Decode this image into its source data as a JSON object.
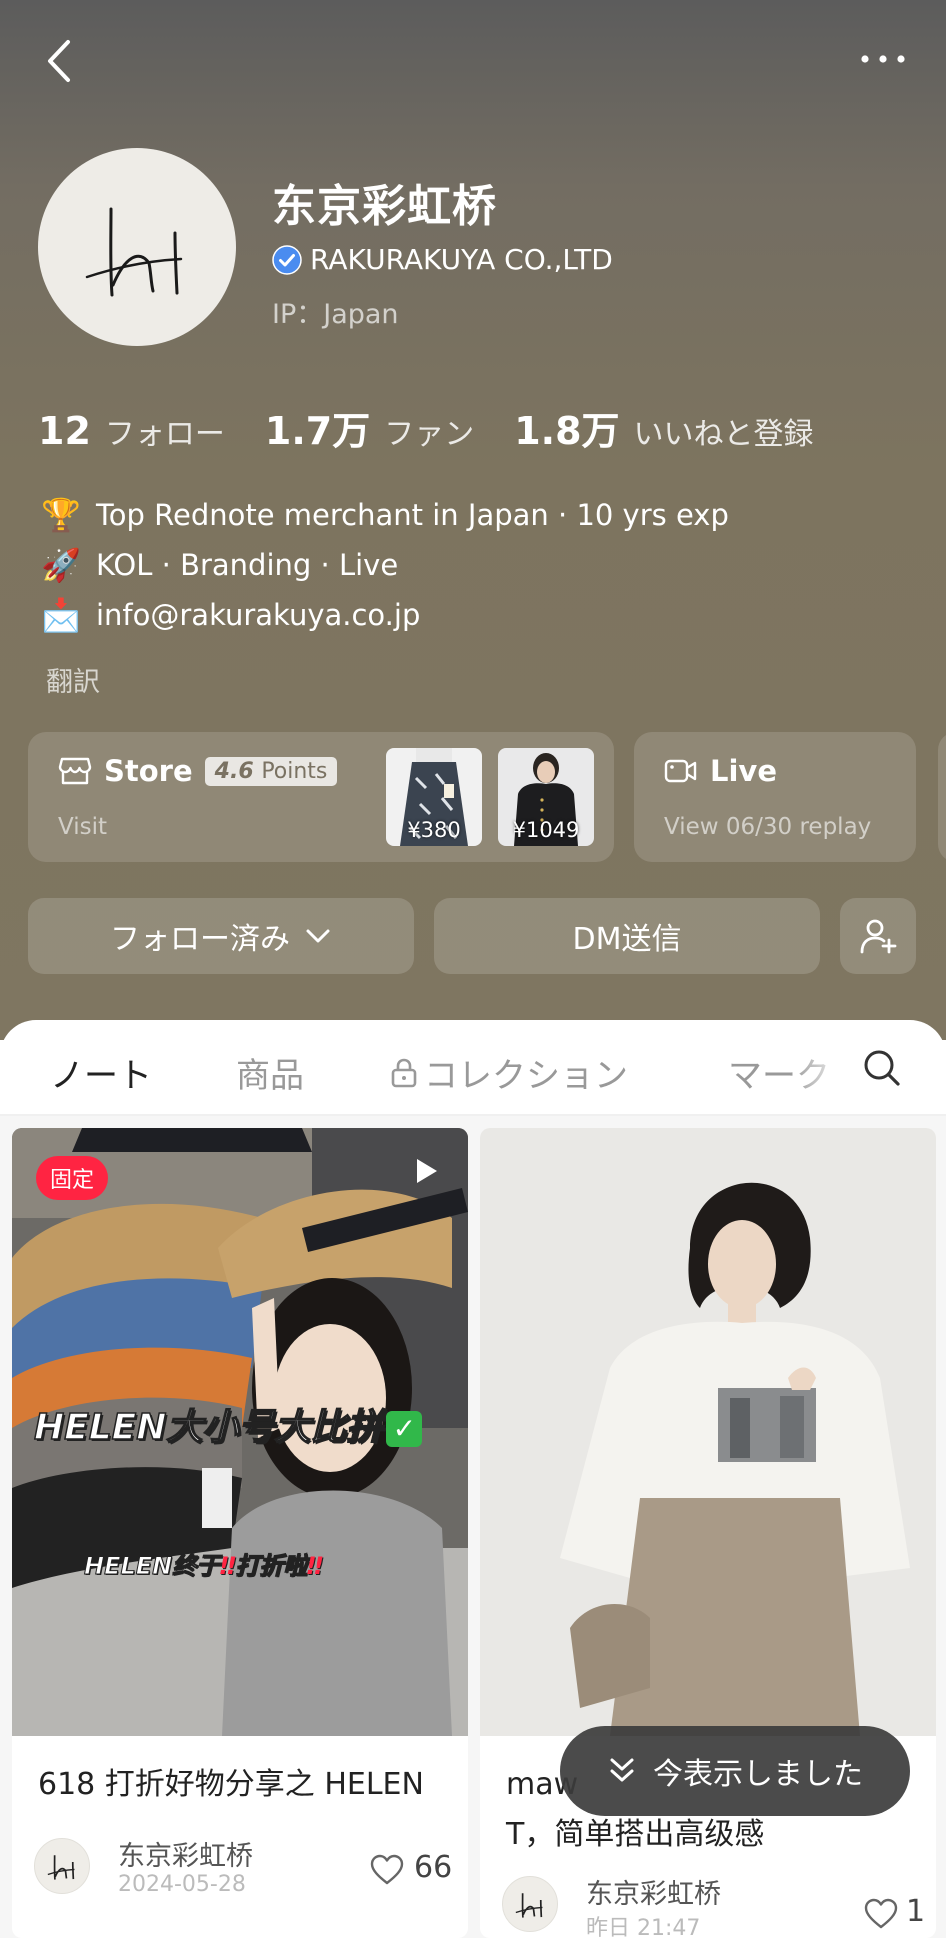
{
  "profile": {
    "name": "东京彩虹桥",
    "company": "RAKURAKUYA CO.,LTD",
    "ip": "IP：Japan"
  },
  "stats": [
    {
      "value": "12",
      "label": "フォロー"
    },
    {
      "value": "1.7万",
      "label": "ファン"
    },
    {
      "value": "1.8万",
      "label": "いいねと登録"
    }
  ],
  "bio": [
    {
      "icon": "trophy-icon",
      "emoji": "🏆",
      "text": "Top Rednote merchant in Japan · 10 yrs exp"
    },
    {
      "icon": "rocket-icon",
      "emoji": "🚀",
      "text": "KOL · Branding · Live"
    },
    {
      "icon": "envelope-icon",
      "emoji": "📩",
      "text": "info@rakurakuya.co.jp"
    }
  ],
  "translate_label": "翻訳",
  "store": {
    "title": "Store",
    "points_value": "4.6",
    "points_label": "Points",
    "sub": "Visit",
    "products": [
      {
        "price": "¥380"
      },
      {
        "price": "¥1049"
      }
    ]
  },
  "live": {
    "title": "Live",
    "sub": "View 06/30 replay"
  },
  "actions": {
    "follow_label": "フォロー済み",
    "dm_label": "DM送信"
  },
  "tabs": [
    {
      "label": "ノート",
      "active": true
    },
    {
      "label": "商品",
      "active": false
    },
    {
      "label": "コレクション",
      "active": false,
      "locked": true
    },
    {
      "label": "マーク",
      "active": false
    }
  ],
  "notes": [
    {
      "pinned_label": "固定",
      "overlay_main": "HELEN大小号大比拼",
      "overlay_sub_a": "HELEN终于",
      "overlay_sub_b": "打折啦",
      "title": "618 打折好物分享之 HELEN",
      "author": "东京彩虹桥",
      "date": "2024-05-28",
      "likes": "66"
    },
    {
      "title": "maw",
      "title_line2": "T，简单搭出高级感",
      "author": "东京彩虹桥",
      "date": "昨日 21:47",
      "likes": "1"
    }
  ],
  "toast": "今表示しました",
  "colors": {
    "accent": "#ff2442",
    "hero_bg": "#7f7661",
    "verified": "#4a8cf0"
  }
}
